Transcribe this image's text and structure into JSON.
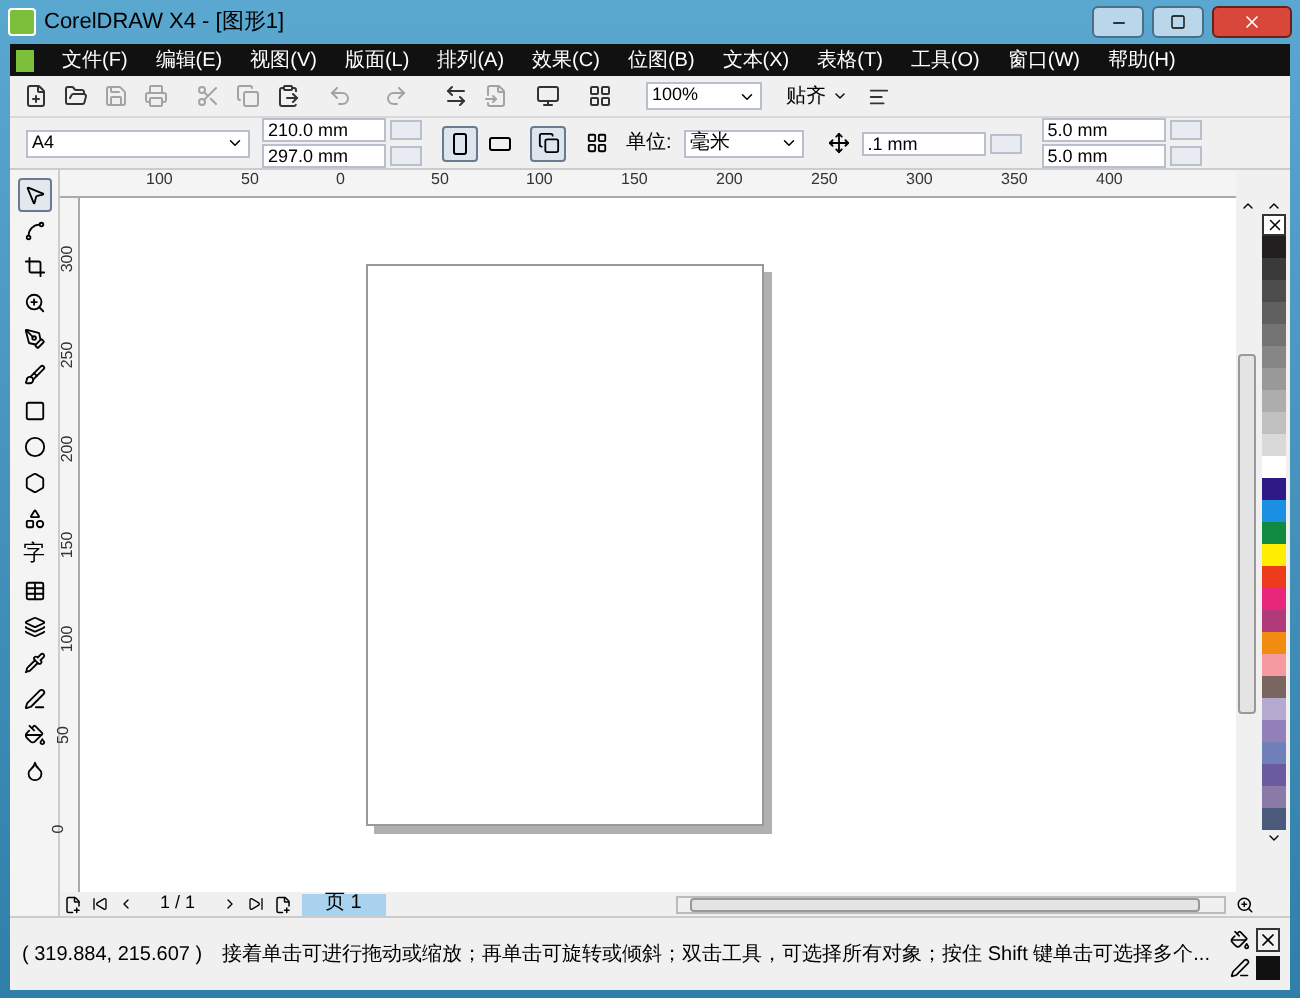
{
  "window": {
    "title": "CorelDRAW X4 - [图形1]"
  },
  "menu": [
    "文件(F)",
    "编辑(E)",
    "视图(V)",
    "版面(L)",
    "排列(A)",
    "效果(C)",
    "位图(B)",
    "文本(X)",
    "表格(T)",
    "工具(O)",
    "窗口(W)",
    "帮助(H)"
  ],
  "standard_toolbar": {
    "zoom": "100%",
    "snap": "贴齐"
  },
  "property_bar": {
    "page_size": "A4",
    "width": "210.0 mm",
    "height": "297.0 mm",
    "orientation": [
      {
        "kind": "portrait",
        "selected": true
      },
      {
        "kind": "landscape",
        "selected": false
      }
    ],
    "unit_label": "单位:",
    "unit": "毫米",
    "nudge": ".1 mm",
    "duplicate_x": "5.0 mm",
    "duplicate_y": "5.0 mm"
  },
  "horizontal_ruler": [
    "100",
    "50",
    "0",
    "50",
    "100",
    "150",
    "200",
    "250",
    "300",
    "350",
    "400"
  ],
  "vertical_ruler": [
    "300",
    "250",
    "200",
    "150",
    "100",
    "50",
    "0"
  ],
  "toolbox": [
    {
      "kind": "pick",
      "selected": true
    },
    {
      "kind": "shape",
      "selected": false
    },
    {
      "kind": "crop",
      "selected": false
    },
    {
      "kind": "zoom",
      "selected": false
    },
    {
      "kind": "curve",
      "selected": false
    },
    {
      "kind": "smart",
      "selected": false
    },
    {
      "kind": "rectangle",
      "selected": false
    },
    {
      "kind": "ellipse",
      "selected": false
    },
    {
      "kind": "polygon",
      "selected": false
    },
    {
      "kind": "shapes",
      "selected": false
    },
    {
      "kind": "text",
      "label": "字",
      "selected": false
    },
    {
      "kind": "table",
      "selected": false
    },
    {
      "kind": "blend",
      "selected": false
    },
    {
      "kind": "eyedropper",
      "selected": false
    },
    {
      "kind": "outline",
      "selected": false
    },
    {
      "kind": "fill",
      "selected": false
    },
    {
      "kind": "interactive_fill",
      "selected": false
    }
  ],
  "palette": [
    {
      "color": "#231f20"
    },
    {
      "color": "#3b3a3a"
    },
    {
      "color": "#4d4d4d"
    },
    {
      "color": "#606060"
    },
    {
      "color": "#737373"
    },
    {
      "color": "#868686"
    },
    {
      "color": "#999999"
    },
    {
      "color": "#adadad"
    },
    {
      "color": "#c0c0c0"
    },
    {
      "color": "#d9d9d9"
    },
    {
      "color": "#ffffff"
    },
    {
      "color": "#2e1a87"
    },
    {
      "color": "#1a8fe3"
    },
    {
      "color": "#0f8a3e"
    },
    {
      "color": "#ffee00"
    },
    {
      "color": "#ee3b1c"
    },
    {
      "color": "#e8267a"
    },
    {
      "color": "#b13b7a"
    },
    {
      "color": "#f28c10"
    },
    {
      "color": "#f49aa0"
    },
    {
      "color": "#7a6560"
    },
    {
      "color": "#b5a9d0"
    },
    {
      "color": "#9281b8"
    },
    {
      "color": "#7080b8"
    },
    {
      "color": "#6a5aa0"
    },
    {
      "color": "#8a7aa8"
    },
    {
      "color": "#4a5a7a"
    }
  ],
  "page_navigator": {
    "position": "1 / 1",
    "tabs": [
      {
        "label": "页 1",
        "selected": true
      }
    ]
  },
  "status_bar": {
    "coordinates": "( 319.884, 215.607 )",
    "hint": "接着单击可进行拖动或缩放；再单击可旋转或倾斜；双击工具，可选择所有对象；按住 Shift 键单击可选择多个..."
  }
}
